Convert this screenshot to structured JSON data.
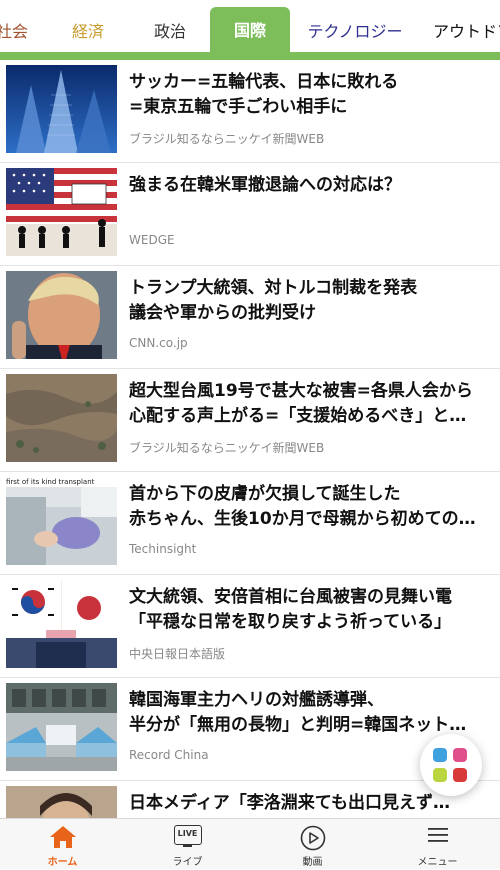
{
  "tabs": [
    {
      "label": "社会",
      "color": "#a0522d"
    },
    {
      "label": "経済",
      "color": "#c89a2c"
    },
    {
      "label": "政治",
      "color": "#333333"
    },
    {
      "label": "国際",
      "color": "#ffffff",
      "active": true
    },
    {
      "label": "テクノロジー",
      "color": "#2f2f8f"
    },
    {
      "label": "アウトドア",
      "color": "#111111"
    }
  ],
  "accent_color": "#7dbd5a",
  "articles": [
    {
      "title": "サッカー=五輪代表、日本に敗れる\n=東京五輪で手ごわい相手に",
      "source": "ブラジル知るならニッケイ新聞WEB",
      "thumb": "city-buildings-photo"
    },
    {
      "title": "強まる在韓米軍撤退論への対応は？",
      "source": "WEDGE",
      "thumb": "us-flag-illustration"
    },
    {
      "title": "トランプ大統領、対トルコ制裁を発表\n議会や軍からの批判受け",
      "source": "CNN.co.jp",
      "thumb": "trump-photo"
    },
    {
      "title": "超大型台風19号で甚大な被害=各県人会から\n心配する声上がる=「支援始めるべき」と…",
      "source": "ブラジル知るならニッケイ新聞WEB",
      "thumb": "flood-aerial-photo"
    },
    {
      "title": "首から下の皮膚が欠損して誕生した\n赤ちゃん、生後10か月で母親から初めての…",
      "source": "Techinsight",
      "thumb": "hospital-baby-photo",
      "thumb_caption": "first of its kind transplant"
    },
    {
      "title": "文大統領、安倍首相に台風被害の見舞い電\n「平穏な日常を取り戻すよう祈っている」",
      "source": "中央日報日本語版",
      "thumb": "korea-japan-flags-photo"
    },
    {
      "title": "韓国海軍主力ヘリの対艦誘導弾、\n半分が「無用の長物」と判明=韓国ネット…",
      "source": "Record China",
      "thumb": "naval-base-photo"
    },
    {
      "title": "日本メディア「李洛淵来ても出口見えず…",
      "source": "",
      "thumb": "person-photo"
    }
  ],
  "bottom_nav": [
    {
      "label": "ホーム",
      "icon": "home-icon",
      "active": true
    },
    {
      "label": "ライブ",
      "icon": "live-tv-icon",
      "icon_text": "LIVE"
    },
    {
      "label": "動画",
      "icon": "play-circle-icon"
    },
    {
      "label": "メニュー",
      "icon": "hamburger-menu-icon"
    }
  ],
  "fab_icon": "app-grid-icon"
}
